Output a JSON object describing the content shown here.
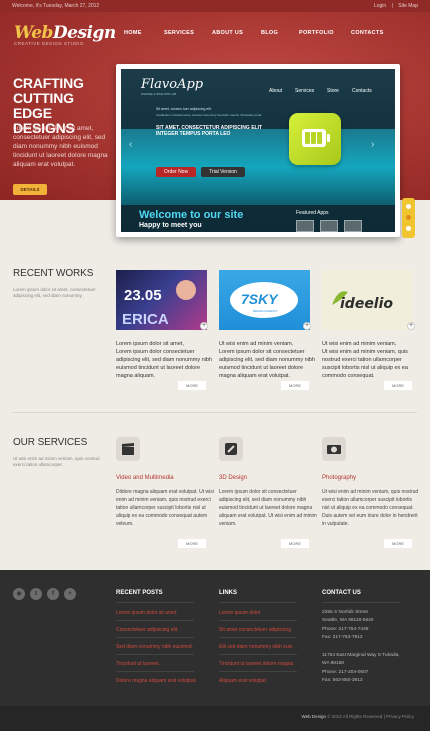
{
  "topbar": {
    "welcome": "Welcome, It's Tuesday, March 27, 2012",
    "login": "Login",
    "sitemap": "Site Map"
  },
  "logo": {
    "part1": "Web",
    "part2": "Design",
    "tagline": "CREATIVE DESIGN STUDIO"
  },
  "nav": [
    "HOME",
    "SERVICES",
    "ABOUT US",
    "BLOG",
    "PORTFOLIO",
    "CONTACTS"
  ],
  "hero": {
    "title": "CRAFTING CUTTING EDGE DESIGNS",
    "text": "Lorem ipsum dolor sit amet, consectetuer adipiscing elit, sed diam nonummy nibh euismod tincidunt ut laoreet dolore magna aliquam erat volutpat.",
    "button": "DETAILS"
  },
  "slide": {
    "logo": "FlavoApp",
    "logo_sub": "IPHONE & IPAD APP LAB",
    "nav": [
      "About",
      "Services",
      "Store",
      "Contacts"
    ],
    "small1": "Sit amet, consec tuer adipiscing elit.",
    "small2": "Vestibulum molestie lacus. Aenean nonummy hendrerit mauris. Phasellus porta.",
    "headline": "SIT AMET, CONSECTETUR ADIPISCING ELIT INTEGER TEMPUS PORTA LEO",
    "order": "Order Now",
    "trial": "Trial Version",
    "welcome": "Welcome to our site",
    "happy": "Happy to meet you",
    "featured": "Featured Apps"
  },
  "works": {
    "title": "RECENT WORKS",
    "desc": "Lorem ipsum dolor sit amet, consectetuer adipiscing elit, sed diam nonummy.",
    "items": [
      {
        "img_text": "23.05",
        "img_text2": "ERICA",
        "title": "Lorem ipsum dolor sit amet,",
        "text": "Lorem ipsum dolor consectetuer adipiscing elit, sed diam nonummy nibh euismod tincidunt ut laoreet dolore magna aliquam."
      },
      {
        "img_text": "7SKY",
        "img_text2": "DESIGN AGENCY",
        "title": "Ut wisi enim ad minim veniam,",
        "text": "Lorem ipsum dolor sit consectetuer adipiscing elit, sed diam nonummy nibh euismod tincidunt ut laoreet dolore magna aliquam erat volutpat."
      },
      {
        "img_text": "ideelio",
        "img_text2": "",
        "title": "Ut wisi enim ad minim veniam,",
        "text": "Ut wisi enim ad minim veniam, quis nostrud exerci tation ullamcorper suscipit lobortis nisl ut aliquip ex ea commodo consequat."
      }
    ],
    "more": "MORE"
  },
  "services": {
    "title": "OUR SERVICES",
    "desc": "Ut wisi enim ad minim veniam, quis nostrud exerci tation ullamcorper.",
    "items": [
      {
        "icon": "clapperboard-icon",
        "title": "Video and Multimedia",
        "text": "Dildore magna aliquam erat volutpat. Ut wisi enim ad minim veniam, quis nostrud exerci tation ullamcorper suscipit lobortis nisl ut aliquip ex ea commodo consequat autem veleum."
      },
      {
        "icon": "pencil-icon",
        "title": "3D Design",
        "text": "Lorem ipsum dolor sit consectetuer adipiscing elit, sed diam nonummy nibh euismod tincidunt ut laoreet dolore magna aliquam erat volutpat. Ut wisi enim ad minim veniam."
      },
      {
        "icon": "camera-icon",
        "title": "Photography",
        "text": "Ut wisi enim ad minim veniam, quis nostrud exerci tation ullamcorper suscipit lobortis nisl ut aliquip ex ea commodo consequat. Duis autem vel eum iriure dolor in hendrerit in vulputate."
      }
    ],
    "more": "MORE"
  },
  "footer": {
    "posts_title": "RECENT POSTS",
    "posts": [
      "Lorem ipsum dolor sit amet.",
      "Consectetuer adipiscing elit.",
      "Sed diam nonummy nibh euismod.",
      "Tincidunt ut laoreet.",
      "Dolore magna aliquam erat volutpat."
    ],
    "links_title": "LINKS",
    "links": [
      "Lorem ipsum dolor",
      "Sit amet consectetuer adipiscing",
      "Elit sed diam nonummy nibh euis",
      "Tincidunt ut laoreet dolore magna",
      "Aliquam erat volutpat"
    ],
    "contact_title": "CONTACT US",
    "contact": [
      "2256 S Norfolk Street",
      "Seattle, WA 98118-5640",
      "Phone: 217-764-7449",
      "Fax: 217-763-7912",
      "11754 East Marginal Way S Tukwila,",
      "WA 98168",
      "Phone: 217-204-0607",
      "Fax: 563-850-3913"
    ],
    "copyright_brand": "Web Design",
    "copyright": "© 2012 All Rights Reserved  |  Privacy Policy"
  },
  "colors": {
    "brand_red": "#a93833",
    "accent_yellow": "#f2b23a",
    "footer_dark": "#2f2f2f",
    "link_red": "#d14a3c"
  }
}
